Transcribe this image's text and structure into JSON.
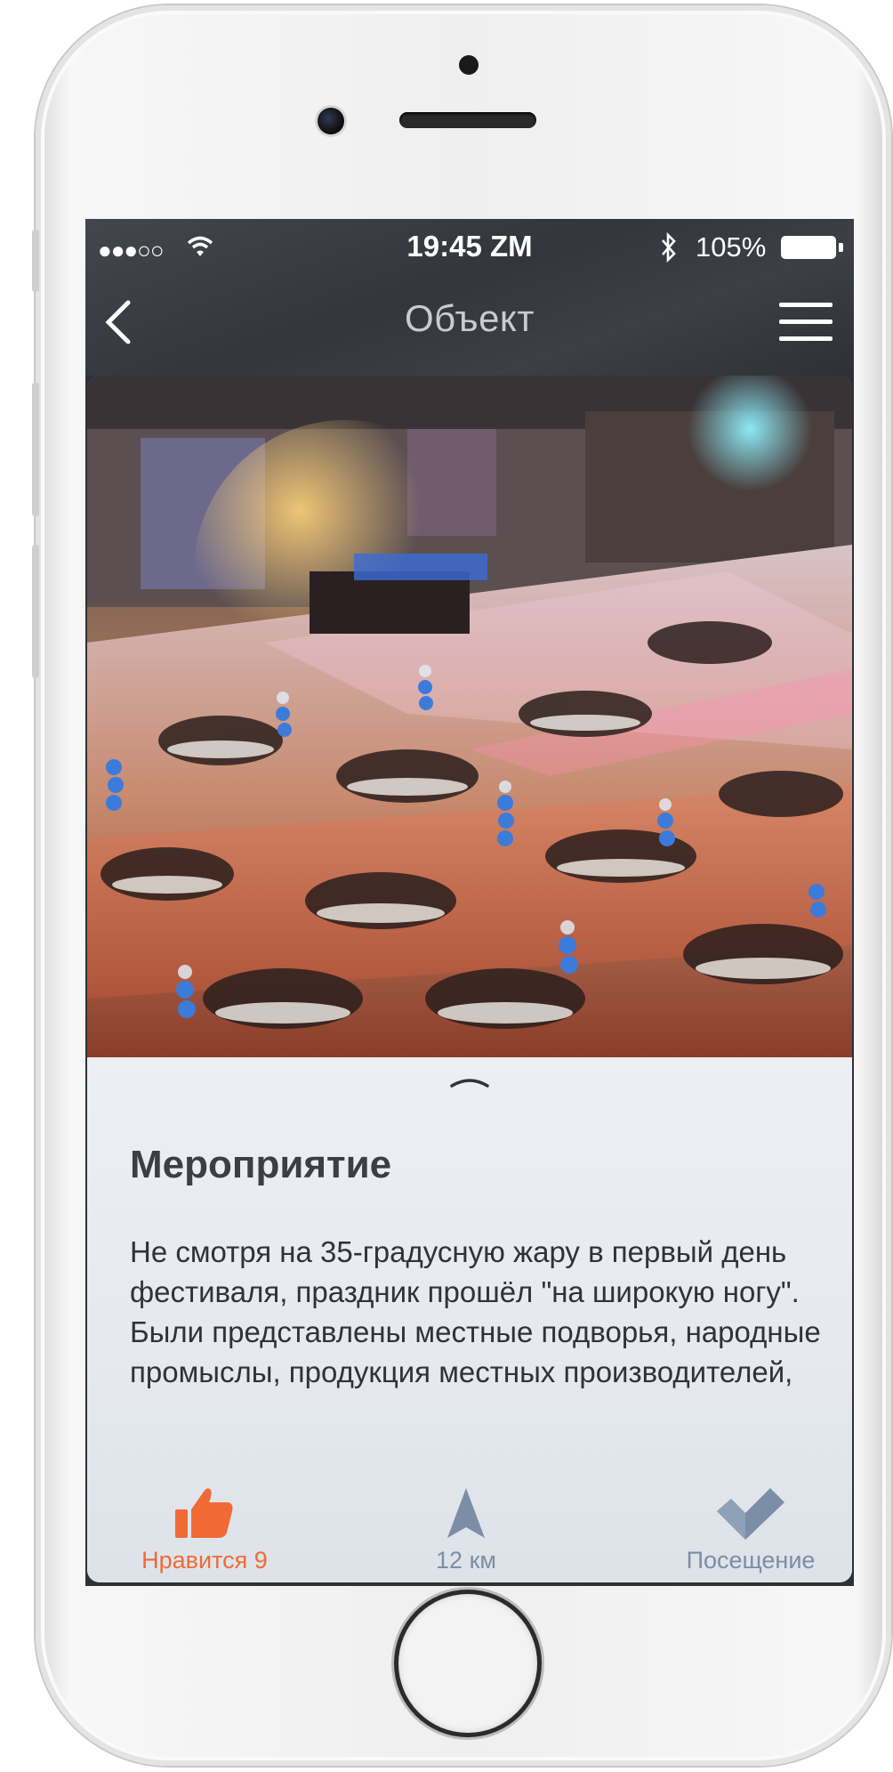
{
  "statusbar": {
    "signal": "●●●○○",
    "time": "19:45 ZM",
    "bluetooth_icon": "bluetooth-icon",
    "battery_percent": "105%"
  },
  "navbar": {
    "title": "Объект",
    "back_icon": "chevron-left-icon",
    "menu_icon": "hamburger-menu-icon"
  },
  "event": {
    "image_alt": "Праздничный банкет в зале",
    "heading": "Мероприятие",
    "description": "Не смотря на 35-градусную жару в первый день фестиваля, праздник прошёл \"на широкую ногу\". Были представлены местные подворья, народные промыслы, продукция местных производителей,"
  },
  "actions": {
    "like_label": "Нравится 9",
    "distance_label": "12 км",
    "visit_label": "Посещение"
  },
  "colors": {
    "accent_orange": "#f06a35",
    "muted_blue": "#7b8ea5",
    "topbar": "#3b3e45"
  }
}
